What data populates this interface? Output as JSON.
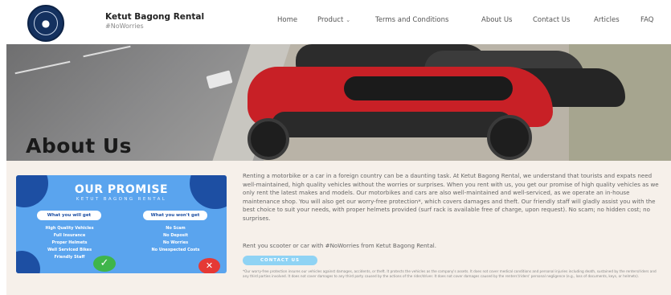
{
  "header": {
    "logo_text": "KETUT BAGONG",
    "brand_title": "Ketut Bagong Rental",
    "brand_tag": "#NoWorries",
    "nav": [
      {
        "label": "Home"
      },
      {
        "label": "Product"
      },
      {
        "label": "Terms and Conditions"
      },
      {
        "label": "About Us"
      },
      {
        "label": "Contact Us"
      },
      {
        "label": "Articles"
      },
      {
        "label": "FAQ"
      }
    ]
  },
  "hero": {
    "title": "About Us"
  },
  "promise": {
    "title": "OUR PROMISE",
    "subtitle": "KETUT BAGONG RENTAL",
    "get_label": "What you will get",
    "wont_label": "What you won't get",
    "get_items": [
      "High Quality Vehicles",
      "Full Insurance",
      "Proper Helmets",
      "Well Serviced Bikes",
      "Friendly Staff"
    ],
    "wont_items": [
      "No Scam",
      "No Deposit",
      "No Worries",
      "No Unexpected Costs"
    ]
  },
  "about": {
    "paragraph1": "Renting a motorbike or a car in a foreign country can be a daunting task. At Ketut Bagong Rental, we understand that tourists and expats need well-maintained, high quality vehicles without the worries or surprises. When you rent with us, you get our promise of high quality vehicles as we only rent the latest makes and models. Our motorbikes and cars are also well-maintained and well-serviced, as we operate an in-house maintenance shop. You will also get our worry-free protection*, which covers damages and theft. Our friendly staff will gladly assist you with the best choice to suit your needs, with proper helmets provided (surf rack is available free of charge, upon request). No scam; no hidden cost; no surprises.",
    "paragraph2": "Rent you scooter or car with #NoWorries from Ketut Bagong Rental.",
    "contact_button": "CONTACT US",
    "disclaimer": "*Our worry-free protection insures our vehicles against damages, accidents, or theft. It protects the vehicles as the company's assets. It does not cover medical conditions and personal injuries including death, sustained by the renters/riders and any third parties involved. It does not cover damages to any third party caused by the actions of the rider/driver. It does not cover damages caused by the renters'/riders' personal negligence (e.g., loss of documents, keys, or helmets)."
  },
  "colors": {
    "promise_bg": "#5aa4ee",
    "promise_dark": "#1d4fa3",
    "content_bg": "#f6f0ea",
    "button": "#8fd3f4",
    "check": "#3fb54a",
    "cross": "#e53935"
  }
}
